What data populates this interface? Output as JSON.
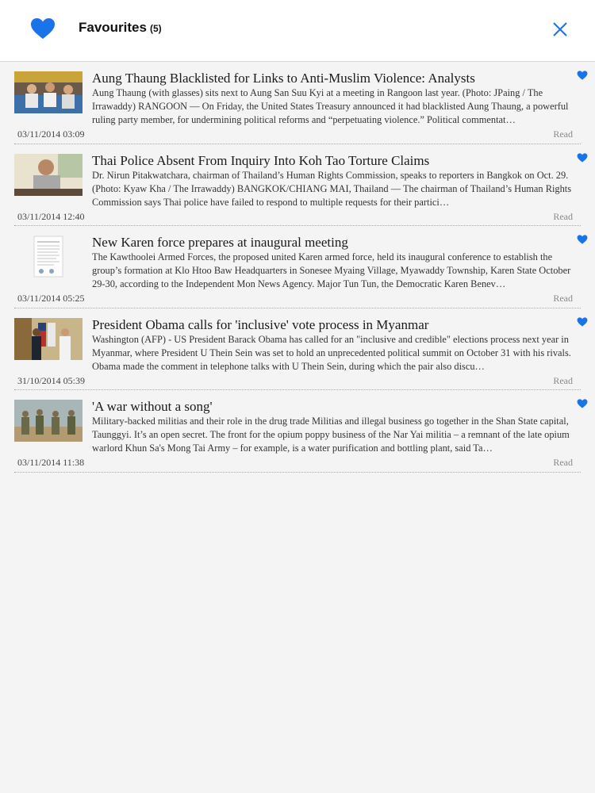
{
  "header": {
    "title": "Favourites",
    "count": "(5)",
    "accent_color": "#1a73e8",
    "heart_icon": "heart-icon",
    "close_icon": "close-icon"
  },
  "articles": [
    {
      "title": "Aung Thaung Blacklisted for Links to Anti-Muslim Violence: Analysts",
      "description": "Aung Thaung (with glasses) sits next to Aung San Suu Kyi at a meeting in Rangoon last year. (Photo: JPaing / The Irrawaddy)   RANGOON — On Friday, the United States Treasury announced it had blacklisted Aung Thaung, a powerful ruling party member, for undermining political reforms and “perpetuating violence.”  Political commentat…",
      "date": "03/11/2014 03:09",
      "read_label": "Read"
    },
    {
      "title": "Thai Police Absent From Inquiry Into Koh Tao Torture Claims",
      "description": "Dr. Nirun Pitakwatchara, chairman of Thailand’s Human Rights Commission, speaks to reporters in Bangkok on Oct. 29. (Photo: Kyaw Kha / The Irrawaddy)   BANGKOK/CHIANG MAI, Thailand — The chairman of Thailand’s Human Rights Commission says Thai police have failed to respond to multiple requests for their partici…",
      "date": "03/11/2014 12:40",
      "read_label": "Read"
    },
    {
      "title": "New Karen force prepares at inaugural meeting",
      "description": "The Kawthoolei Armed Forces, the proposed united Karen armed force, held its inaugural conference to establish the group’s formation at Klo Htoo Baw Headquarters in Sonesee Myaing Village, Myawaddy Township, Karen State October 29-30, according to the Independent Mon News Agency.    Major Tun Tun, the Democratic Karen Benev…",
      "date": "03/11/2014 05:25",
      "read_label": "Read"
    },
    {
      "title": "President Obama calls for 'inclusive' vote process in Myanmar",
      "description": "Washington (AFP) - US President Barack Obama has called for an \"inclusive and credible\" elections process next year in Myanmar, where President U Thein Sein was set to hold an unprecedented political summit on October 31 with his rivals.    Obama made the comment in telephone talks with U Thein Sein, during which the pair also discu…",
      "date": "31/10/2014 05:39",
      "read_label": "Read"
    },
    {
      "title": "'A war without a song'",
      "description": "Military-backed militias and their role in the drug trade  Militias and illegal business go together in the Shan State capital, Taunggyi. It’s an open secret. The front for the opium poppy business of the Nar Yai militia – a remnant of the late opium warlord Khun Sa's Mong Tai Army – for example, is a water purification and bottling plant, said Ta…",
      "date": "03/11/2014 11:38",
      "read_label": "Read"
    }
  ]
}
